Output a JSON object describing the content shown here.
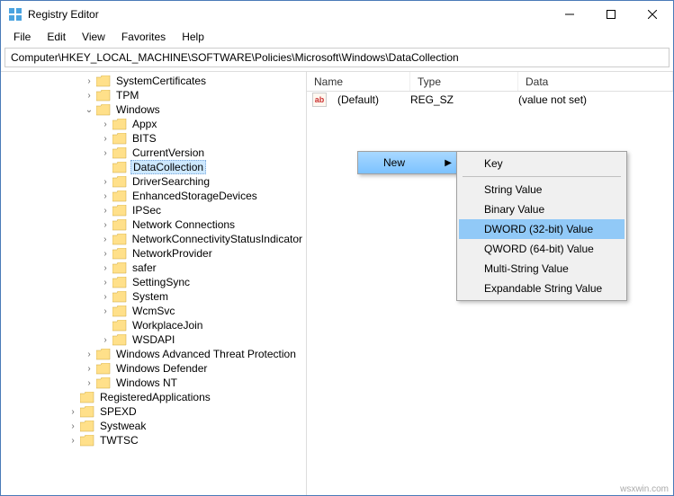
{
  "window": {
    "title": "Registry Editor"
  },
  "menu": {
    "file": "File",
    "edit": "Edit",
    "view": "View",
    "favorites": "Favorites",
    "help": "Help"
  },
  "address": "Computer\\HKEY_LOCAL_MACHINE\\SOFTWARE\\Policies\\Microsoft\\Windows\\DataCollection",
  "tree": {
    "items": [
      "SystemCertificates",
      "TPM",
      "Windows",
      "Appx",
      "BITS",
      "CurrentVersion",
      "DataCollection",
      "DriverSearching",
      "EnhancedStorageDevices",
      "IPSec",
      "Network Connections",
      "NetworkConnectivityStatusIndicator",
      "NetworkProvider",
      "safer",
      "SettingSync",
      "System",
      "WcmSvc",
      "WorkplaceJoin",
      "WSDAPI",
      "Windows Advanced Threat Protection",
      "Windows Defender",
      "Windows NT",
      "RegisteredApplications",
      "SPEXD",
      "Systweak",
      "TWTSC"
    ]
  },
  "list": {
    "headers": {
      "name": "Name",
      "type": "Type",
      "data": "Data"
    },
    "row0": {
      "name": "(Default)",
      "type": "REG_SZ",
      "data": "(value not set)",
      "icon": "ab"
    }
  },
  "contextmenu": {
    "new": "New",
    "sub": {
      "key": "Key",
      "string": "String Value",
      "binary": "Binary Value",
      "dword": "DWORD (32-bit) Value",
      "qword": "QWORD (64-bit) Value",
      "multi": "Multi-String Value",
      "expand": "Expandable String Value"
    }
  },
  "watermark": "wsxwin.com"
}
